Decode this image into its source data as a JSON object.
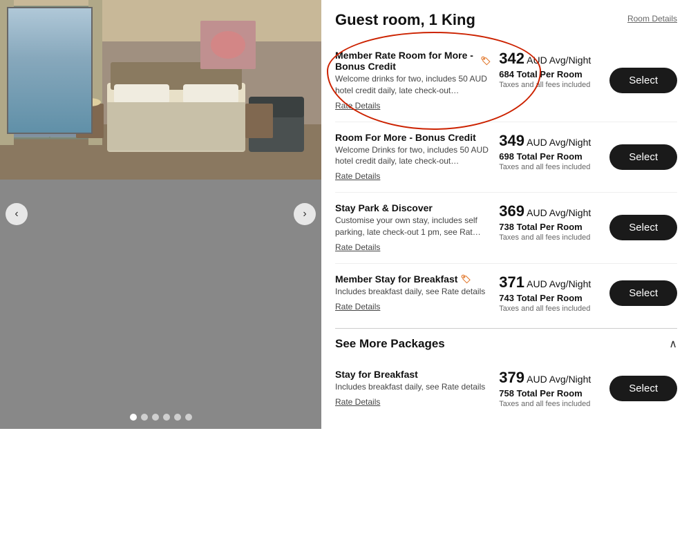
{
  "room": {
    "title": "Guest room, 1 King",
    "details_link": "Room Details",
    "carousel_dots": 6
  },
  "rates": [
    {
      "id": "member-rate-bonus",
      "name": "Member Rate Room for More - Bonus Credit",
      "has_tag": true,
      "desc": "Welcome drinks for two, includes 50 AUD hotel credit daily, late check-out…",
      "details_link": "Rate Details",
      "price": "342",
      "price_unit": "AUD Avg/Night",
      "price_total": "684 Total Per Room",
      "price_taxes": "Taxes and all fees included",
      "is_highlighted": true
    },
    {
      "id": "room-for-more-bonus",
      "name": "Room For More - Bonus Credit",
      "has_tag": false,
      "desc": "Welcome Drinks for two, includes 50 AUD hotel credit daily, late check-out…",
      "details_link": "Rate Details",
      "price": "349",
      "price_unit": "AUD Avg/Night",
      "price_total": "698 Total Per Room",
      "price_taxes": "Taxes and all fees included",
      "is_highlighted": false
    },
    {
      "id": "stay-park-discover",
      "name": "Stay Park & Discover",
      "has_tag": false,
      "desc": "Customise your own stay, includes self parking, late check-out 1 pm, see Rat…",
      "details_link": "Rate Details",
      "price": "369",
      "price_unit": "AUD Avg/Night",
      "price_total": "738 Total Per Room",
      "price_taxes": "Taxes and all fees included",
      "is_highlighted": false
    },
    {
      "id": "member-stay-breakfast",
      "name": "Member Stay for Breakfast",
      "has_tag": true,
      "desc": "Includes breakfast daily, see Rate details",
      "details_link": "Rate Details",
      "price": "371",
      "price_unit": "AUD Avg/Night",
      "price_total": "743 Total Per Room",
      "price_taxes": "Taxes and all fees included",
      "is_highlighted": false
    }
  ],
  "see_more": {
    "title": "See More Packages",
    "packages": [
      {
        "id": "stay-for-breakfast",
        "name": "Stay for Breakfast",
        "has_tag": false,
        "desc": "Includes breakfast daily, see Rate details",
        "details_link": "Rate Details",
        "price": "379",
        "price_unit": "AUD Avg/Night",
        "price_total": "758 Total Per Room",
        "price_taxes": "Taxes and all fees included"
      }
    ]
  },
  "buttons": {
    "select_label": "Select",
    "prev_label": "‹",
    "next_label": "›"
  }
}
